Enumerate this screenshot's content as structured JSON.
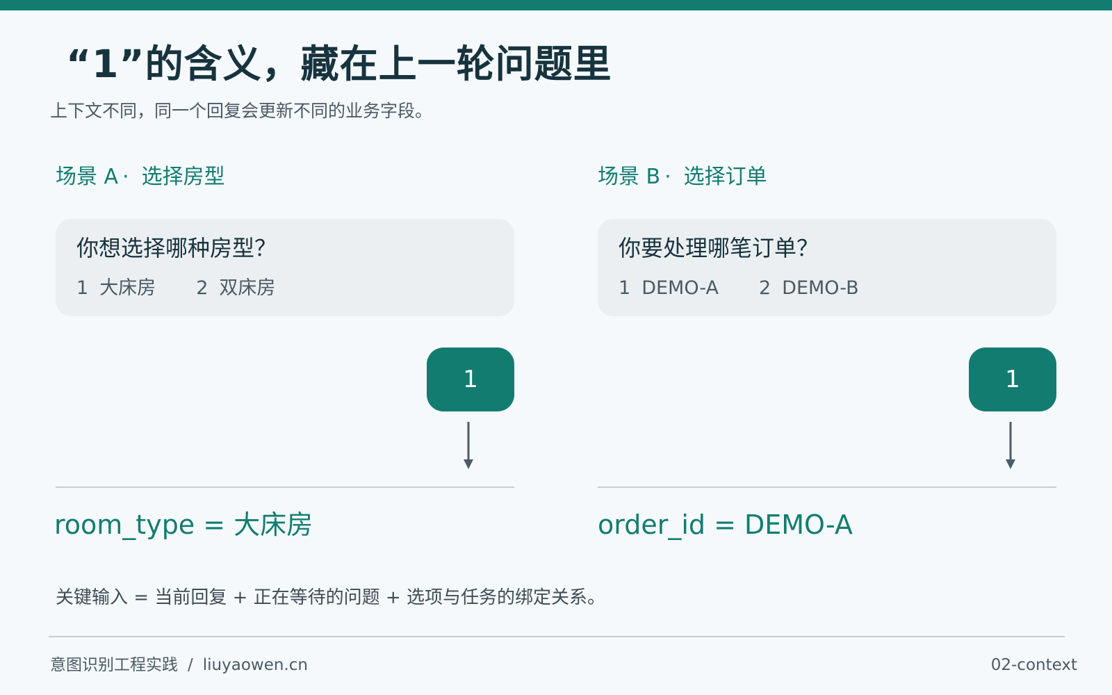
{
  "title": "“1”的含义，藏在上一轮问题里",
  "subtitle": "上下文不同，同一个回复会更新不同的业务字段。",
  "scenarios": [
    {
      "label": "场景 A",
      "separator": "·",
      "name": "选择房型",
      "question": "你想选择哪种房型？",
      "options": [
        {
          "num": "1",
          "text": "大床房"
        },
        {
          "num": "2",
          "text": "双床房"
        }
      ],
      "reply": "1",
      "result": "room_type = 大床房"
    },
    {
      "label": "场景 B",
      "separator": "·",
      "name": "选择订单",
      "question": "你要处理哪笔订单？",
      "options": [
        {
          "num": "1",
          "text": "DEMO-A"
        },
        {
          "num": "2",
          "text": "DEMO-B"
        }
      ],
      "reply": "1",
      "result": "order_id = DEMO-A"
    }
  ],
  "summary": "关键输入 = 当前回复 + 正在等待的问题 + 选项与任务的绑定关系。",
  "footer": {
    "left": "意图识别工程实践",
    "separator": "/",
    "site": "liuyaowen.cn",
    "right": "02-context"
  },
  "colors": {
    "accent": "#127c70",
    "background": "#f5f9fc",
    "card": "#eceff2",
    "heading": "#17333e",
    "arrow": "#4b5b68"
  },
  "icons": {
    "arrow": "arrow-down-icon"
  }
}
